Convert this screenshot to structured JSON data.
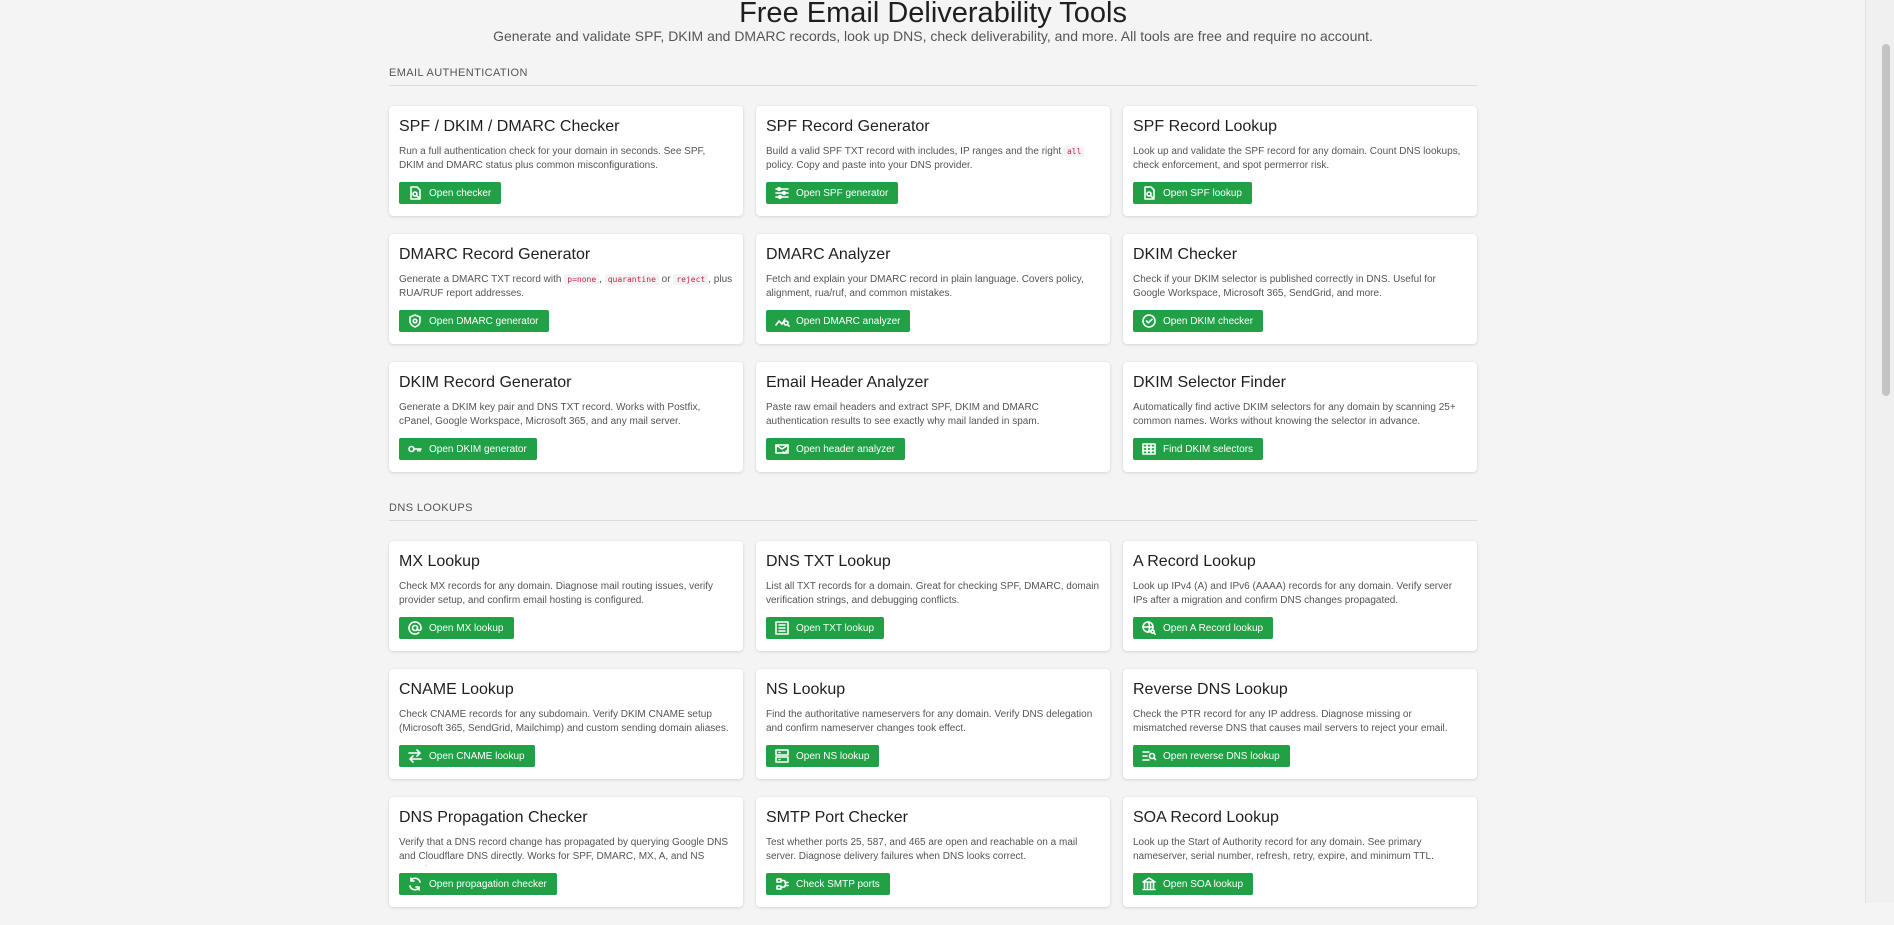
{
  "hero": {
    "title": "Free Email Deliverability Tools",
    "subtitle": "Generate and validate SPF, DKIM and DMARC records, look up DNS, check deliverability, and more. All tools are free and require no account."
  },
  "sections": [
    {
      "label": "Email Authentication",
      "cards": [
        {
          "title": "SPF / DKIM / DMARC Checker",
          "desc": "Run a full authentication check for your domain in seconds. See SPF, DKIM and DMARC status plus common misconfigurations.",
          "button": "Open checker",
          "icon": "doc-search-icon"
        },
        {
          "title": "SPF Record Generator",
          "desc_parts": [
            "Build a valid SPF TXT record with includes, IP ranges and the right ",
            {
              "code": "all"
            },
            " policy. Copy and paste into your DNS provider."
          ],
          "button": "Open SPF generator",
          "icon": "sliders-icon"
        },
        {
          "title": "SPF Record Lookup",
          "desc": "Look up and validate the SPF record for any domain. Count DNS lookups, check enforcement, and spot permerror risk.",
          "button": "Open SPF lookup",
          "icon": "doc-search-icon"
        },
        {
          "title": "DMARC Record Generator",
          "desc_parts": [
            "Generate a DMARC TXT record with ",
            {
              "code": "p=none"
            },
            ", ",
            {
              "code": "quarantine"
            },
            " or ",
            {
              "code": "reject"
            },
            ", plus RUA/RUF report addresses."
          ],
          "button": "Open DMARC generator",
          "icon": "shield-icon"
        },
        {
          "title": "DMARC Analyzer",
          "desc": "Fetch and explain your DMARC record in plain language. Covers policy, alignment, rua/ruf, and common mistakes.",
          "button": "Open DMARC analyzer",
          "icon": "graph-search-icon"
        },
        {
          "title": "DKIM Checker",
          "desc": "Check if your DKIM selector is published correctly in DNS. Useful for Google Workspace, Microsoft 365, SendGrid, and more.",
          "button": "Open DKIM checker",
          "icon": "badge-check-icon"
        },
        {
          "title": "DKIM Record Generator",
          "desc": "Generate a DKIM key pair and DNS TXT record. Works with Postfix, cPanel, Google Workspace, Microsoft 365, and any mail server.",
          "button": "Open DKIM generator",
          "icon": "key-icon"
        },
        {
          "title": "Email Header Analyzer",
          "desc": "Paste raw email headers and extract SPF, DKIM and DMARC authentication results to see exactly why mail landed in spam.",
          "button": "Open header analyzer",
          "icon": "envelope-check-icon"
        },
        {
          "title": "DKIM Selector Finder",
          "desc": "Automatically find active DKIM selectors for any domain by scanning 25+ common names. Works without knowing the selector in advance.",
          "button": "Find DKIM selectors",
          "icon": "grid-icon"
        }
      ]
    },
    {
      "label": "DNS Lookups",
      "cards": [
        {
          "title": "MX Lookup",
          "desc": "Check MX records for any domain. Diagnose mail routing issues, verify provider setup, and confirm email hosting is configured.",
          "button": "Open MX lookup",
          "icon": "at-icon"
        },
        {
          "title": "DNS TXT Lookup",
          "desc": "List all TXT records for a domain. Great for checking SPF, DMARC, domain verification strings, and debugging conflicts.",
          "button": "Open TXT lookup",
          "icon": "list-icon"
        },
        {
          "title": "A Record Lookup",
          "desc": "Look up IPv4 (A) and IPv6 (AAAA) records for any domain. Verify server IPs after a migration and confirm DNS changes propagated.",
          "button": "Open A Record lookup",
          "icon": "globe-search-icon"
        },
        {
          "title": "CNAME Lookup",
          "desc": "Check CNAME records for any subdomain. Verify DKIM CNAME setup (Microsoft 365, SendGrid, Mailchimp) and custom sending domain aliases.",
          "button": "Open CNAME lookup",
          "icon": "arrows-swap-icon"
        },
        {
          "title": "NS Lookup",
          "desc": "Find the authoritative nameservers for any domain. Verify DNS delegation and confirm nameserver changes took effect.",
          "button": "Open NS lookup",
          "icon": "server-icon"
        },
        {
          "title": "Reverse DNS Lookup",
          "desc": "Check the PTR record for any IP address. Diagnose missing or mismatched reverse DNS that causes mail servers to reject your email.",
          "button": "Open reverse DNS lookup",
          "icon": "list-search-icon"
        },
        {
          "title": "DNS Propagation Checker",
          "desc": "Verify that a DNS record change has propagated by querying Google DNS and Cloudflare DNS directly. Works for SPF, DMARC, MX, A, and NS records.",
          "button": "Open propagation checker",
          "icon": "refresh-icon"
        },
        {
          "title": "SMTP Port Checker",
          "desc": "Test whether ports 25, 587, and 465 are open and reachable on a mail server. Diagnose delivery failures when DNS looks correct.",
          "button": "Check SMTP ports",
          "icon": "plug-icon"
        },
        {
          "title": "SOA Record Lookup",
          "desc": "Look up the Start of Authority record for any domain. See primary nameserver, serial number, refresh, retry, expire, and minimum TTL.",
          "button": "Open SOA lookup",
          "icon": "bank-icon"
        }
      ]
    }
  ],
  "colors": {
    "accent": "#21a046",
    "background": "#f4f4f4",
    "code": "#c7254e"
  }
}
